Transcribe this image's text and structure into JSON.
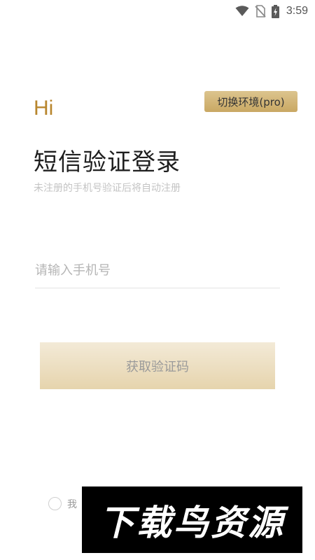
{
  "status_bar": {
    "time": "3:59",
    "icons": [
      "wifi-icon",
      "no-sim-icon",
      "battery-charging-icon"
    ]
  },
  "greeting": "Hi",
  "switch_env_label": "切换环境(pro)",
  "title": "短信验证登录",
  "subtitle": "未注册的手机号验证后将自动注册",
  "phone_input": {
    "value": "",
    "placeholder": "请输入手机号"
  },
  "get_code_label": "获取验证码",
  "agreement": {
    "text_visible": "我"
  },
  "watermark": "下载鸟资源",
  "colors": {
    "accent_gold": "#b8862e",
    "button_gold": "#dcc48e",
    "button_disabled": "#efe3c8"
  }
}
